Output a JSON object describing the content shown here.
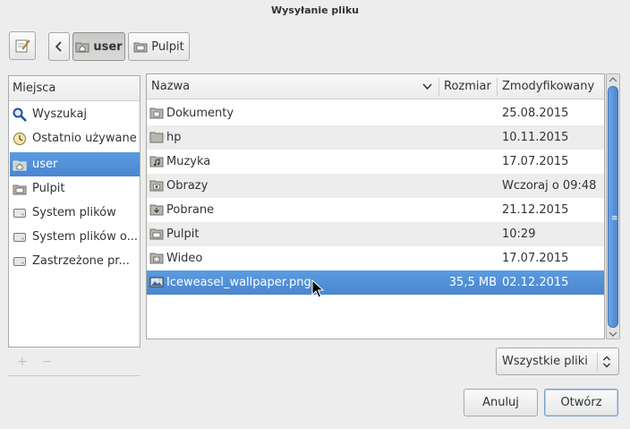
{
  "window": {
    "title": "Wysyłanie pliku"
  },
  "toolbar": {
    "edit_icon": "edit-pencil-icon",
    "back_icon": "chevron-left-icon",
    "crumbs": [
      {
        "label": "user",
        "icon": "home-folder-icon",
        "active": true
      },
      {
        "label": "Pulpit",
        "icon": "desktop-folder-icon",
        "active": false
      }
    ]
  },
  "sidebar": {
    "header": "Miejsca",
    "items": [
      {
        "label": "Wyszukaj",
        "icon": "search-icon"
      },
      {
        "label": "Ostatnio używane",
        "icon": "recent-clock-icon"
      },
      {
        "label": "user",
        "icon": "home-folder-icon",
        "selected": true
      },
      {
        "label": "Pulpit",
        "icon": "desktop-folder-icon"
      },
      {
        "label": "System plików",
        "icon": "drive-icon"
      },
      {
        "label": "System plików o...",
        "icon": "drive-icon"
      },
      {
        "label": "Zastrzeżone pr...",
        "icon": "drive-icon"
      }
    ],
    "add_label": "+",
    "remove_label": "−"
  },
  "files": {
    "columns": {
      "name": "Nazwa",
      "size": "Rozmiar",
      "modified": "Zmodyfikowany"
    },
    "rows": [
      {
        "name": "Dokumenty",
        "size": "",
        "modified": "25.08.2015",
        "icon": "documents-folder-icon"
      },
      {
        "name": "hp",
        "size": "",
        "modified": "10.11.2015",
        "icon": "folder-icon"
      },
      {
        "name": "Muzyka",
        "size": "",
        "modified": "17.07.2015",
        "icon": "music-folder-icon"
      },
      {
        "name": "Obrazy",
        "size": "",
        "modified": "Wczoraj o 09:48",
        "icon": "pictures-folder-icon"
      },
      {
        "name": "Pobrane",
        "size": "",
        "modified": "21.12.2015",
        "icon": "downloads-folder-icon"
      },
      {
        "name": "Pulpit",
        "size": "",
        "modified": "10:29",
        "icon": "desktop-folder-icon"
      },
      {
        "name": "Wideo",
        "size": "",
        "modified": "17.07.2015",
        "icon": "video-folder-icon"
      },
      {
        "name": "Iceweasel_wallpaper.png",
        "size": "35,5 MB",
        "modified": "02.12.2015",
        "icon": "image-file-icon",
        "selected": true
      }
    ]
  },
  "filter": {
    "label": "Wszystkie pliki"
  },
  "actions": {
    "cancel": "Anuluj",
    "open": "Otwórz"
  },
  "colors": {
    "selection": "#4a86cf",
    "background": "#ededed"
  }
}
